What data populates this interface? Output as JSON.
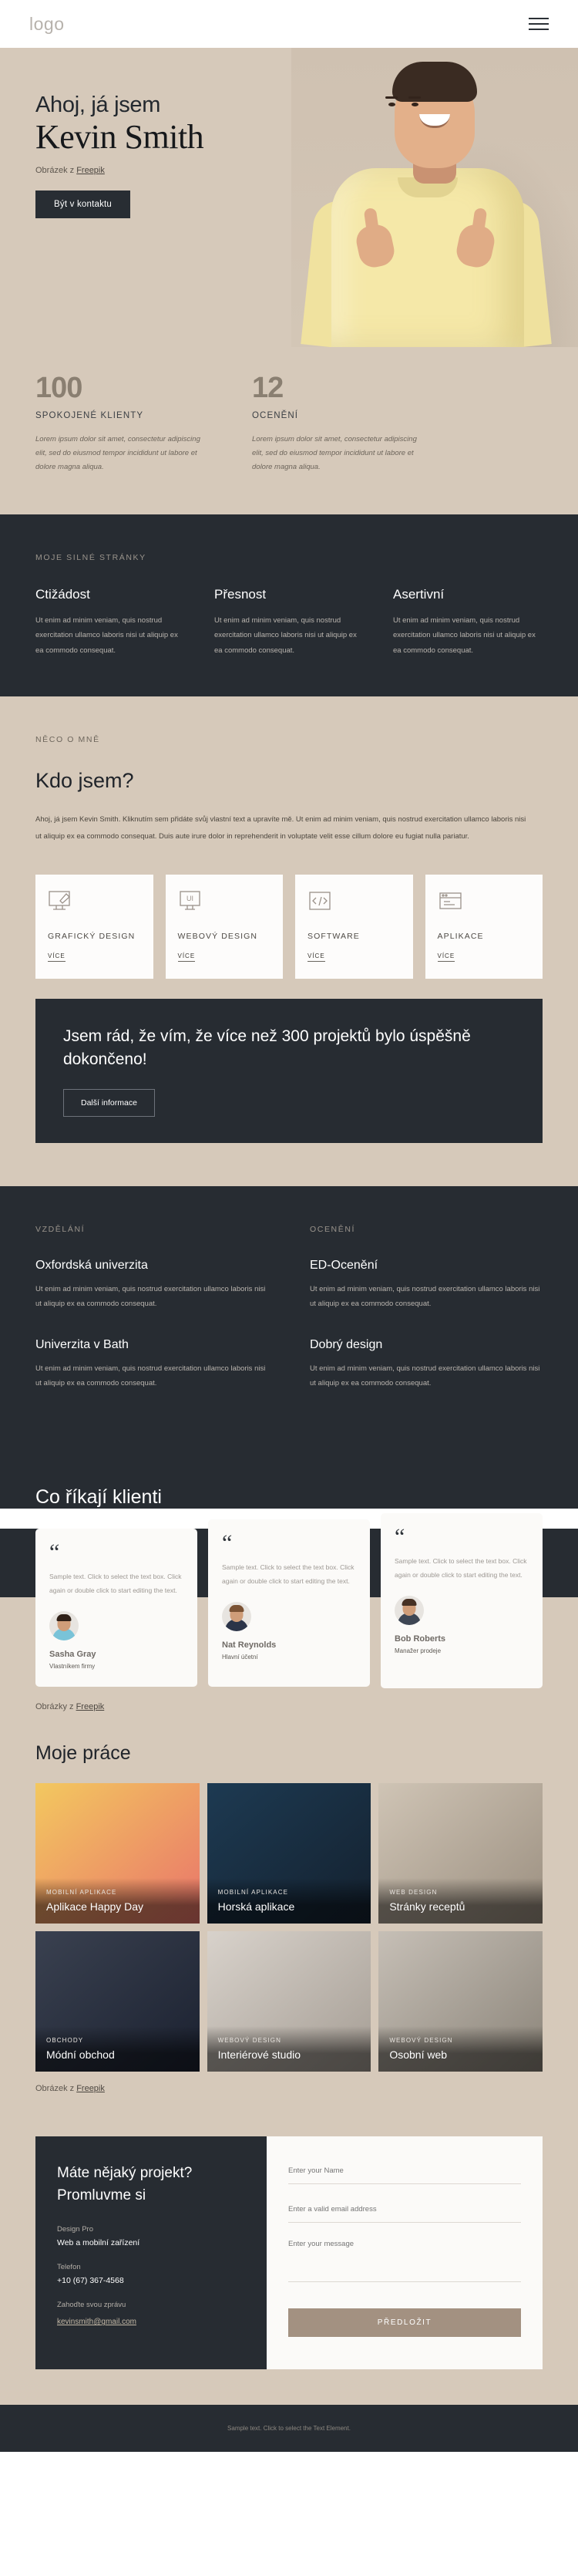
{
  "header": {
    "logo": "logo",
    "menu_icon": "hamburger-icon"
  },
  "hero": {
    "greeting": "Ahoj, já jsem",
    "name": "Kevin Smith",
    "credit_prefix": "Obrázek z ",
    "credit_link": "Freepik",
    "cta": "Být v kontaktu"
  },
  "stats": [
    {
      "number": "100",
      "label": "SPOKOJENÉ KLIENTY",
      "desc": "Lorem ipsum dolor sit amet, consectetur adipiscing elit, sed do eiusmod tempor incididunt ut labore et dolore magna aliqua."
    },
    {
      "number": "12",
      "label": "OCENĚNÍ",
      "desc": "Lorem ipsum dolor sit amet, consectetur adipiscing elit, sed do eiusmod tempor incididunt ut labore et dolore magna aliqua."
    }
  ],
  "strengths": {
    "eyebrow": "MOJE SILNÉ STRÁNKY",
    "items": [
      {
        "title": "Ctižádost",
        "body": "Ut enim ad minim veniam, quis nostrud exercitation ullamco laboris nisi ut aliquip ex ea commodo consequat."
      },
      {
        "title": "Přesnost",
        "body": "Ut enim ad minim veniam, quis nostrud exercitation ullamco laboris nisi ut aliquip ex ea commodo consequat."
      },
      {
        "title": "Asertivní",
        "body": "Ut enim ad minim veniam, quis nostrud exercitation ullamco laboris nisi ut aliquip ex ea commodo consequat."
      }
    ]
  },
  "about": {
    "eyebrow": "NĚCO O MNĚ",
    "title": "Kdo jsem?",
    "body": "Ahoj, já jsem Kevin Smith. Kliknutím sem přidáte svůj vlastní text a upravíte mě. Ut enim ad minim veniam, quis nostrud exercitation ullamco laboris nisi ut aliquip ex ea commodo consequat. Duis aute irure dolor in reprehenderit in voluptate velit esse cillum dolore eu fugiat nulla pariatur.",
    "cards": [
      {
        "icon": "graphic-design-icon",
        "title": "GRAFICKÝ DESIGN",
        "more": "VÍCE"
      },
      {
        "icon": "ui-monitor-icon",
        "title": "WEBOVÝ DESIGN",
        "more": "VÍCE"
      },
      {
        "icon": "code-icon",
        "title": "SOFTWARE",
        "more": "VÍCE"
      },
      {
        "icon": "app-window-icon",
        "title": "APLIKACE",
        "more": "VÍCE"
      }
    ]
  },
  "cta_band": {
    "title": "Jsem rád, že vím, že více než 300 projektů bylo úspěšně dokončeno!",
    "button": "Další informace"
  },
  "education": {
    "left_eyebrow": "VZDĚLÁNÍ",
    "right_eyebrow": "OCENĚNÍ",
    "left_items": [
      {
        "title": "Oxfordská univerzita",
        "body": "Ut enim ad minim veniam, quis nostrud exercitation ullamco laboris nisi ut aliquip ex ea commodo consequat."
      },
      {
        "title": "Univerzita v Bath",
        "body": "Ut enim ad minim veniam, quis nostrud exercitation ullamco laboris nisi ut aliquip ex ea commodo consequat."
      }
    ],
    "right_items": [
      {
        "title": "ED-Ocenění",
        "body": "Ut enim ad minim veniam, quis nostrud exercitation ullamco laboris nisi ut aliquip ex ea commodo consequat."
      },
      {
        "title": "Dobrý design",
        "body": "Ut enim ad minim veniam, quis nostrud exercitation ullamco laboris nisi ut aliquip ex ea commodo consequat."
      }
    ]
  },
  "testimonials": {
    "title": "Co říkají klienti",
    "credit_prefix": "Obrázky z ",
    "credit_link": "Freepik",
    "items": [
      {
        "quote_mark": "“",
        "text": "Sample text. Click to select the text box. Click again or double click to start editing the text.",
        "name": "Sasha Gray",
        "role": "Vlastníkem firmy",
        "shirt": "#79c3d8",
        "hair": "#2f2018"
      },
      {
        "quote_mark": "“",
        "text": "Sample text. Click to select the text box. Click again or double click to start editing the text.",
        "name": "Nat Reynolds",
        "role": "Hlavní účetní",
        "shirt": "#2b3448",
        "hair": "#7a5234"
      },
      {
        "quote_mark": "“",
        "text": "Sample text. Click to select the text box. Click again or double click to start editing the text.",
        "name": "Bob Roberts",
        "role": "Manažer prodeje",
        "shirt": "#3d4654",
        "hair": "#463124"
      }
    ]
  },
  "portfolio": {
    "title": "Moje práce",
    "credit_prefix": "Obrázek z ",
    "credit_link": "Freepik",
    "items": [
      {
        "category": "MOBILNÍ APLIKACE",
        "name": "Aplikace Happy Day",
        "c1": "#f3c85f",
        "c2": "#e9746a"
      },
      {
        "category": "MOBILNÍ APLIKACE",
        "name": "Horská aplikace",
        "c1": "#1d3a52",
        "c2": "#14212f"
      },
      {
        "category": "WEB DESIGN",
        "name": "Stránky receptů",
        "c1": "#cfc4b5",
        "c2": "#9b8f80"
      },
      {
        "category": "OBCHODY",
        "name": "Módní obchod",
        "c1": "#3a4150",
        "c2": "#1b2130"
      },
      {
        "category": "WEBOVÝ DESIGN",
        "name": "Interiérové studio",
        "c1": "#d8d2cb",
        "c2": "#a59d94"
      },
      {
        "category": "WEBOVÝ DESIGN",
        "name": "Osobní web",
        "c1": "#c6bfb6",
        "c2": "#8b8479"
      }
    ]
  },
  "contact": {
    "title": "Máte nějaký projekt? Promluvme si",
    "company_label": "Design Pro",
    "company_value": "Web a mobilní zařízení",
    "phone_label": "Telefon",
    "phone_value": "+10 (67) 367-4568",
    "message_label": "Zahoďte svou zprávu",
    "email_link": "kevinsmith@gmail.com",
    "form": {
      "name_placeholder": "Enter your Name",
      "email_placeholder": "Enter a valid email address",
      "message_placeholder": "Enter your message",
      "submit": "PŘEDLOŽIT"
    }
  },
  "footer": {
    "text": "Sample text. Click to select the Text Element."
  },
  "colors": {
    "beige": "#d6c9ba",
    "dark": "#272c32",
    "accent": "#a39181",
    "stat_number": "#8a7f71"
  }
}
